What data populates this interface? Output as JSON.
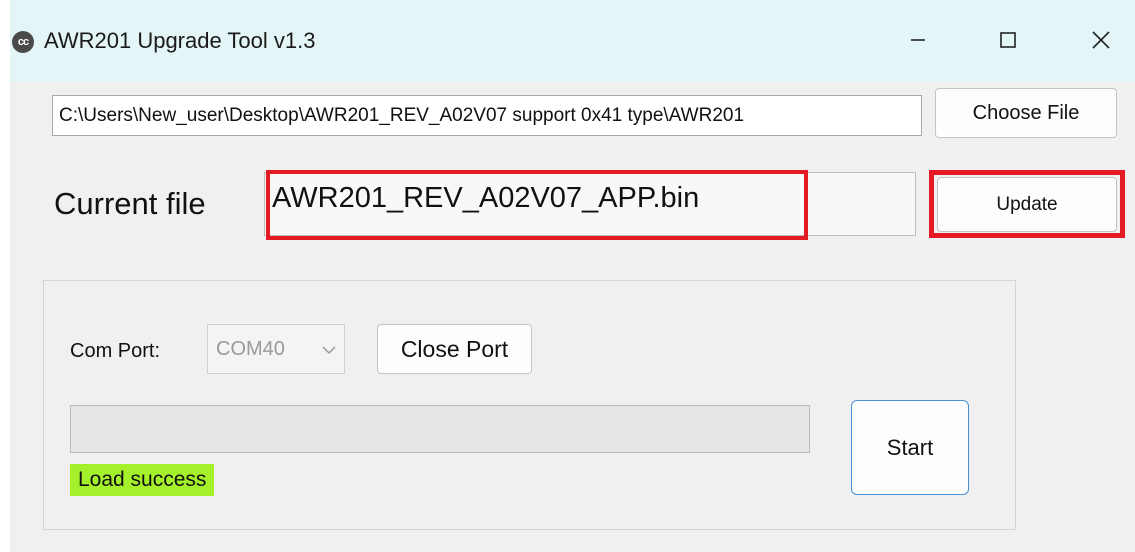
{
  "window": {
    "title": "AWR201 Upgrade Tool v1.3",
    "app_icon_text": "cc",
    "controls": [
      "minimize-icon",
      "maximize-icon",
      "close-icon"
    ]
  },
  "file_path": {
    "value": "C:\\Users\\New_user\\Desktop\\AWR201_REV_A02V07 support 0x41 type\\AWR201",
    "choose_label": "Choose File"
  },
  "current_file": {
    "label": "Current file",
    "value": "AWR201_REV_A02V07_APP.bin",
    "update_label": "Update",
    "highlight_color": "#e31b23"
  },
  "com_port": {
    "label": "Com Port:",
    "selected": "COM40",
    "close_label": "Close Port"
  },
  "progress": {
    "value_fraction": 0
  },
  "start_label": "Start",
  "status": {
    "text": "Load success",
    "color": "#a4f02a"
  }
}
